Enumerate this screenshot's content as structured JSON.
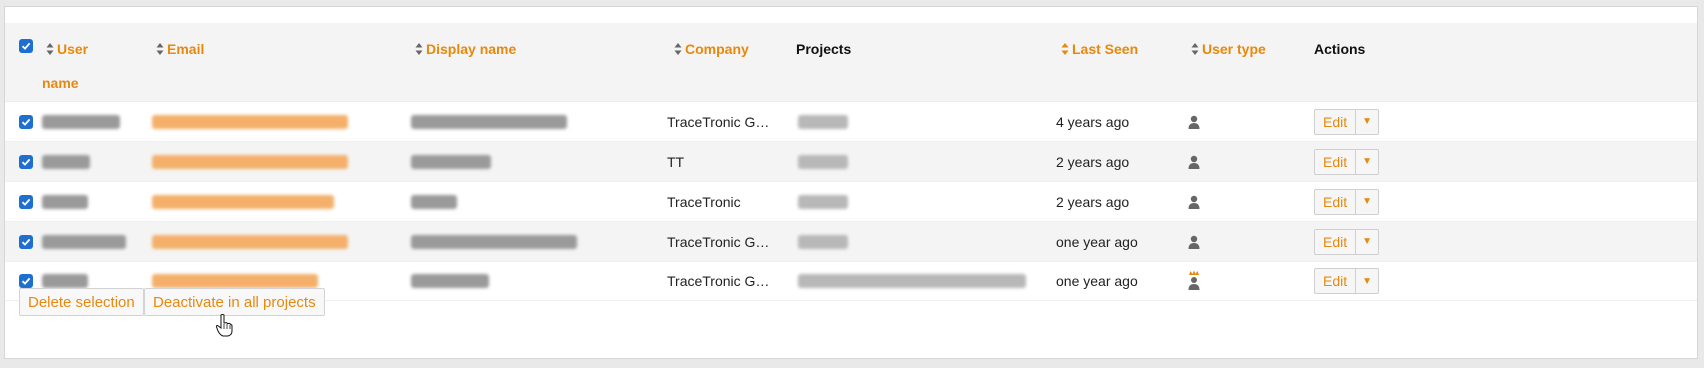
{
  "header": {
    "user_label": "User",
    "user_label_2": "name",
    "email_label": "Email",
    "display_name_label": "Display name",
    "company_label": "Company",
    "projects_label": "Projects",
    "last_seen_label": "Last Seen",
    "user_type_label": "User type",
    "actions_label": "Actions"
  },
  "rows": [
    {
      "company": "TraceTronic G…",
      "last_seen": "4 years ago",
      "user_type_icon": "user-icon",
      "edit_label": "Edit"
    },
    {
      "company": "TT",
      "last_seen": "2 years ago",
      "user_type_icon": "user-icon",
      "edit_label": "Edit"
    },
    {
      "company": "TraceTronic",
      "last_seen": "2 years ago",
      "user_type_icon": "user-icon",
      "edit_label": "Edit"
    },
    {
      "company": "TraceTronic G…",
      "last_seen": "one year ago",
      "user_type_icon": "user-icon",
      "edit_label": "Edit"
    },
    {
      "company": "TraceTronic G…",
      "last_seen": "one year ago",
      "user_type_icon": "admin-crown-user-icon",
      "edit_label": "Edit"
    }
  ],
  "footer": {
    "delete_label": "Delete selection",
    "deactivate_label": "Deactivate in all projects"
  },
  "colors": {
    "accent": "#e8880c",
    "checkbox": "#1f6fd1"
  }
}
